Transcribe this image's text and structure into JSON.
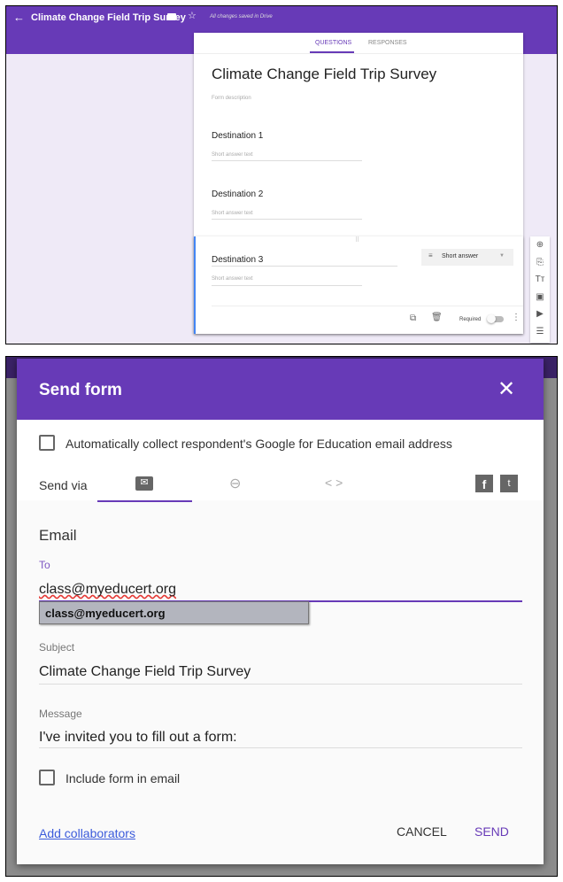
{
  "editor": {
    "title": "Climate Change Field Trip Survey",
    "save_status": "All changes saved in Drive",
    "tabs": [
      "QUESTIONS",
      "RESPONSES"
    ],
    "form_title": "Climate Change Field Trip Survey",
    "form_description": "Form description",
    "questions": [
      {
        "title": "Destination 1",
        "placeholder": "Short answer text"
      },
      {
        "title": "Destination 2",
        "placeholder": "Short answer text"
      },
      {
        "title": "Destination 3",
        "placeholder": "Short answer text"
      }
    ],
    "question_type": "Short answer",
    "required_label": "Required",
    "required": false
  },
  "dialog": {
    "title": "Send form",
    "collect_email_label": "Automatically collect respondent's Google for Education email address",
    "collect_email": false,
    "send_via_label": "Send via",
    "section_title": "Email",
    "to_label": "To",
    "to_value": "class@myeducert.org",
    "suggestion": "class@myeducert.org",
    "subject_label": "Subject",
    "subject_value": "Climate Change Field Trip Survey",
    "message_label": "Message",
    "message_value": "I've invited you to fill out a form:",
    "include_form_label": "Include form in email",
    "include_form": false,
    "add_collaborators": "Add collaborators",
    "cancel": "CANCEL",
    "send": "SEND"
  },
  "colors": {
    "accent": "#673ab7",
    "link": "#3b5bdb"
  }
}
